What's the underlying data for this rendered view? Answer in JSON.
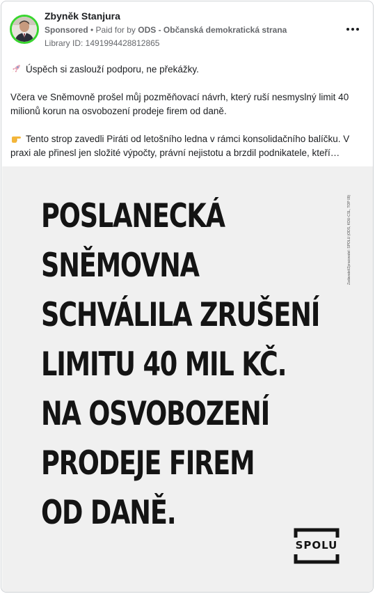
{
  "post": {
    "author": "Zbyněk Stanjura",
    "sponsored": "Sponsored",
    "paid_for_prefix": " • Paid for by ",
    "paid_for_by": "ODS - Občanská demokratická strana",
    "library_id": "Library ID: 1491994428812865",
    "more_icon": "more-dots-icon",
    "avatar_ring_color": "#39d62f"
  },
  "text": {
    "p1": "Úspěch si zaslouží podporu, ne překážky.",
    "p2": "Včera ve Sněmovně prošel můj pozměňovací návrh, který ruší nesmyslný limit 40 milionů korun na osvobození prodeje firem od daně.",
    "p3": "Tento strop zavedli Piráti od letošního ledna v rámci konsolidačního balíčku. V praxi ale přinesl jen složité výpočty, právní nejistotu a brzdil podnikatele, kteří…",
    "emoji1": "rocket-icon",
    "emoji2": "pointing-hand-icon"
  },
  "creative": {
    "headline_lines": [
      "POSLANECKÁ",
      "SNĚMOVNA",
      "SCHVÁLILA ZRUŠENÍ",
      "LIMITU 40 MIL KČ.",
      "NA OSVOBOZENÍ",
      "PRODEJE FIREM",
      "OD DANĚ."
    ],
    "logo_text": "SPOLU",
    "disclaimer": "Zadavatel/Zpracovatel: SPOLU (ODS, KDU-ČSL, TOP 09)",
    "background": "#f0f0f0",
    "text_color": "#141414"
  }
}
